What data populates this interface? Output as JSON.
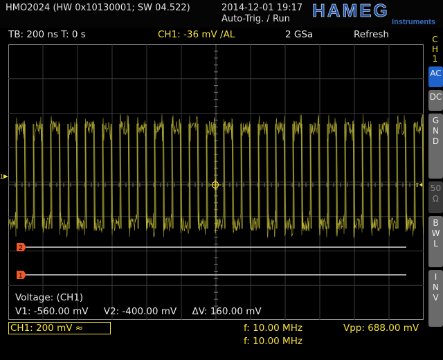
{
  "header": {
    "model_info": "HMO2024 (HW 0x10130001; SW 04.522)",
    "date_time": "2014-12-01 19:17",
    "trigger_status": "Auto-Trig. / Run",
    "brand": "HAMEG",
    "brand_sub": "Instruments"
  },
  "status": {
    "timebase": "TB: 200 ns   T: 0 s",
    "trigger": "CH1: -36 mV ∕AL",
    "sample_rate": "2 GSa",
    "acq_mode": "Refresh"
  },
  "side_panel": {
    "channel": "C\nH\n1",
    "buttons": [
      {
        "label": "AC",
        "active": true
      },
      {
        "label": "DC",
        "active": false
      },
      {
        "label": "G\nN\nD",
        "active": false
      },
      {
        "label": "50\nΩ",
        "active": false,
        "disabled": true
      },
      {
        "label": "B\nW\nL",
        "active": false
      },
      {
        "label": "I\nN\nV",
        "active": false
      }
    ]
  },
  "markers": {
    "cursor2": "2",
    "cursor1": "1",
    "ch1_ground": "1",
    "trigger_right": "T"
  },
  "readout": {
    "title": "Voltage: (CH1)",
    "v1": "V1: -560.00 mV",
    "v2": "V2: -400.00 mV",
    "dv": "ΔV: 160.00 mV"
  },
  "bottom": {
    "ch1_scale": "CH1: 200 mV ≈",
    "freq_1": "f: 10.00 MHz",
    "freq_2": "f: 10.00 MHz",
    "vpp": "Vpp: 688.00 mV"
  },
  "signal": {
    "frequency_mhz": 10,
    "high_level_div": 1.65,
    "low_level_div": -1.15,
    "cycles_on_screen": 24
  },
  "colors": {
    "ch1": "#f4e23c",
    "trace": "#c8c23a",
    "cursor": "#ffffff",
    "marker": "#f05a28",
    "brand": "#1b4d9c"
  }
}
